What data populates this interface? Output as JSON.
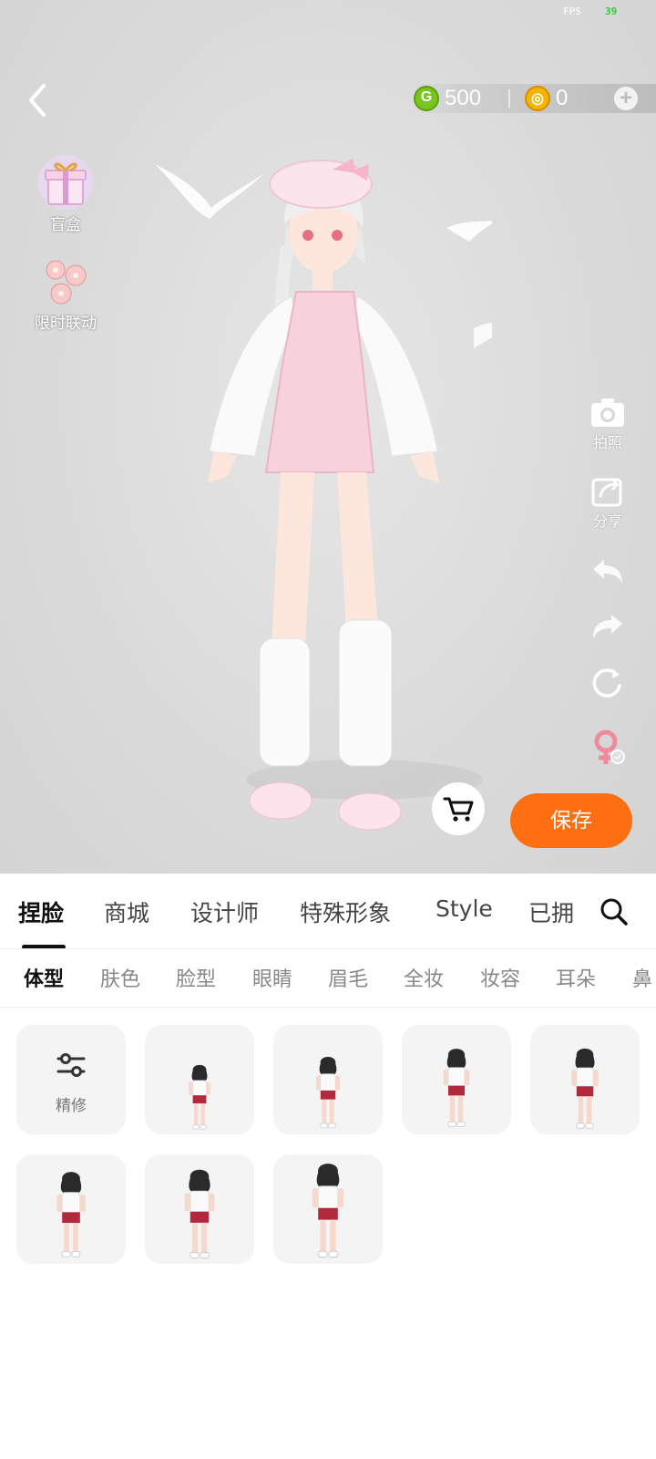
{
  "status": {
    "fps_label": "FPS",
    "fps_value": "39"
  },
  "currency": {
    "green_amount": "500",
    "gold_amount": "0"
  },
  "side_left": [
    {
      "label": "盲盒",
      "icon": "gift-box-icon"
    },
    {
      "label": "限时联动",
      "icon": "cherry-blossom-icon"
    }
  ],
  "side_right": [
    {
      "label": "拍照",
      "icon": "camera-icon"
    },
    {
      "label": "分享",
      "icon": "share-icon"
    },
    {
      "label": "",
      "icon": "undo-icon"
    },
    {
      "label": "",
      "icon": "redo-icon"
    },
    {
      "label": "",
      "icon": "reset-icon"
    },
    {
      "label": "",
      "icon": "female-gender-icon"
    }
  ],
  "actions": {
    "save_label": "保存",
    "cart_icon": "cart-icon"
  },
  "main_tabs": [
    "捏脸",
    "商城",
    "设计师",
    "特殊形象",
    "Style",
    "已拥"
  ],
  "main_active": "捏脸",
  "sub_tabs": [
    "体型",
    "肤色",
    "脸型",
    "眼睛",
    "眉毛",
    "全妆",
    "妆容",
    "耳朵",
    "鼻"
  ],
  "sub_active": "体型",
  "grid": {
    "first_tile_label": "精修",
    "body_preset_count": 7
  },
  "colors": {
    "accent": "#fd6f10",
    "stage_bg": "#dcdcdc"
  }
}
